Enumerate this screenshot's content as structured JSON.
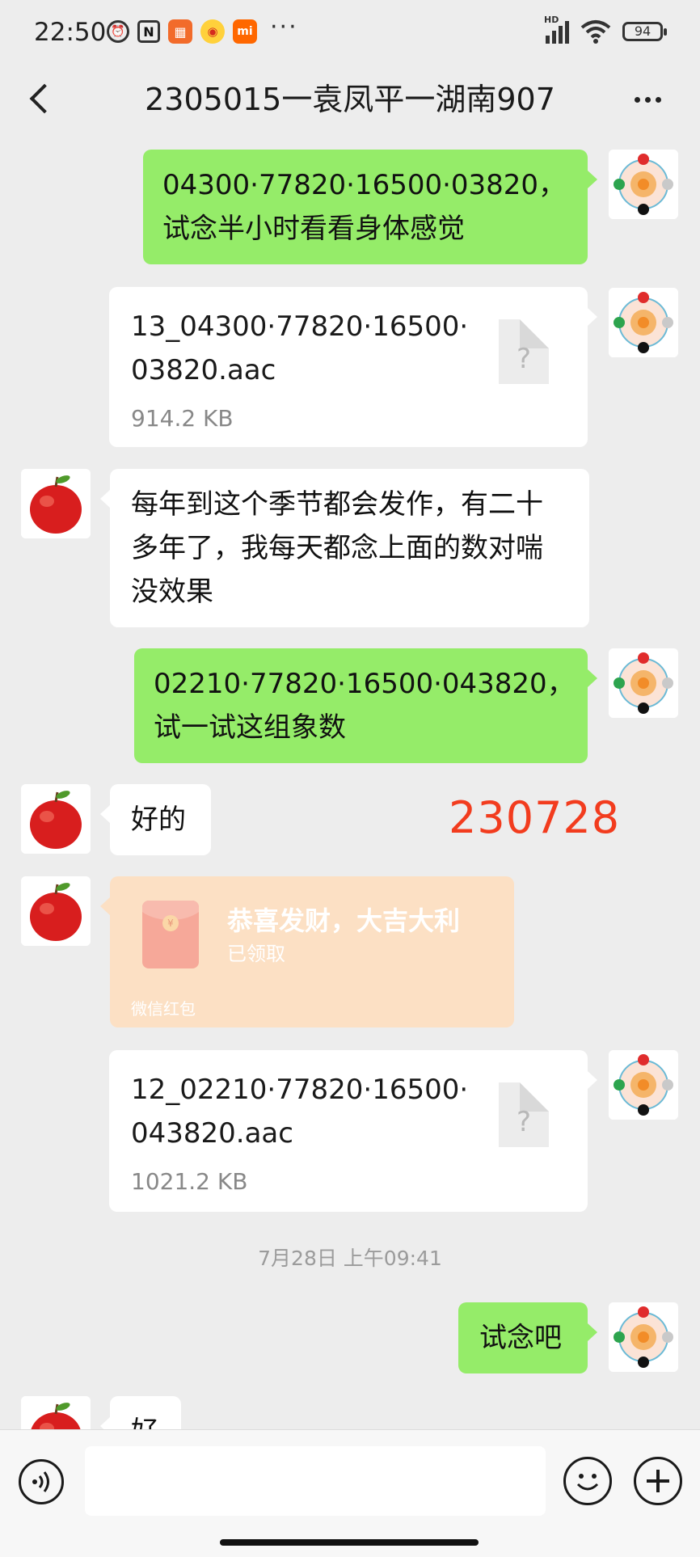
{
  "status_bar": {
    "time": "22:50",
    "battery": "94",
    "network_label": "HD"
  },
  "header": {
    "title": "2305015一袁凤平一湖南907"
  },
  "messages": [
    {
      "from": "me",
      "type": "text",
      "text": "04300·77820·16500·03820，试念半小时看看身体感觉"
    },
    {
      "from": "me",
      "type": "file",
      "name": "13_04300·77820·16500·03820.aac",
      "size": "914.2 KB",
      "icon": "unknown-file-icon"
    },
    {
      "from": "them",
      "type": "text",
      "text": "每年到这个季节都会发作，有二十多年了，我每天都念上面的数对喘没效果"
    },
    {
      "from": "me",
      "type": "text",
      "text": "02210·77820·16500·043820，试一试这组象数"
    },
    {
      "from": "them",
      "type": "text",
      "text": "好的"
    },
    {
      "from": "them",
      "type": "red_packet",
      "title": "恭喜发财，大吉大利",
      "status": "已领取",
      "footer": "微信红包"
    },
    {
      "from": "me",
      "type": "file",
      "name": "12_02210·77820·16500·043820.aac",
      "size": "1021.2 KB",
      "icon": "unknown-file-icon"
    },
    {
      "type": "timestamp",
      "text": "7月28日 上午09:41"
    },
    {
      "from": "me",
      "type": "text",
      "text": "试念吧"
    },
    {
      "from": "them",
      "type": "text",
      "text": "好"
    }
  ],
  "overlay_number": "230728",
  "input_bar": {
    "value": "",
    "icons": [
      "voice-icon",
      "emoji-icon",
      "plus-icon"
    ]
  },
  "colors": {
    "my_bubble": "#95ec69",
    "their_bubble": "#ffffff",
    "background": "#ededed",
    "overlay_number": "#f23c1e",
    "red_packet": "#fce0c4"
  }
}
